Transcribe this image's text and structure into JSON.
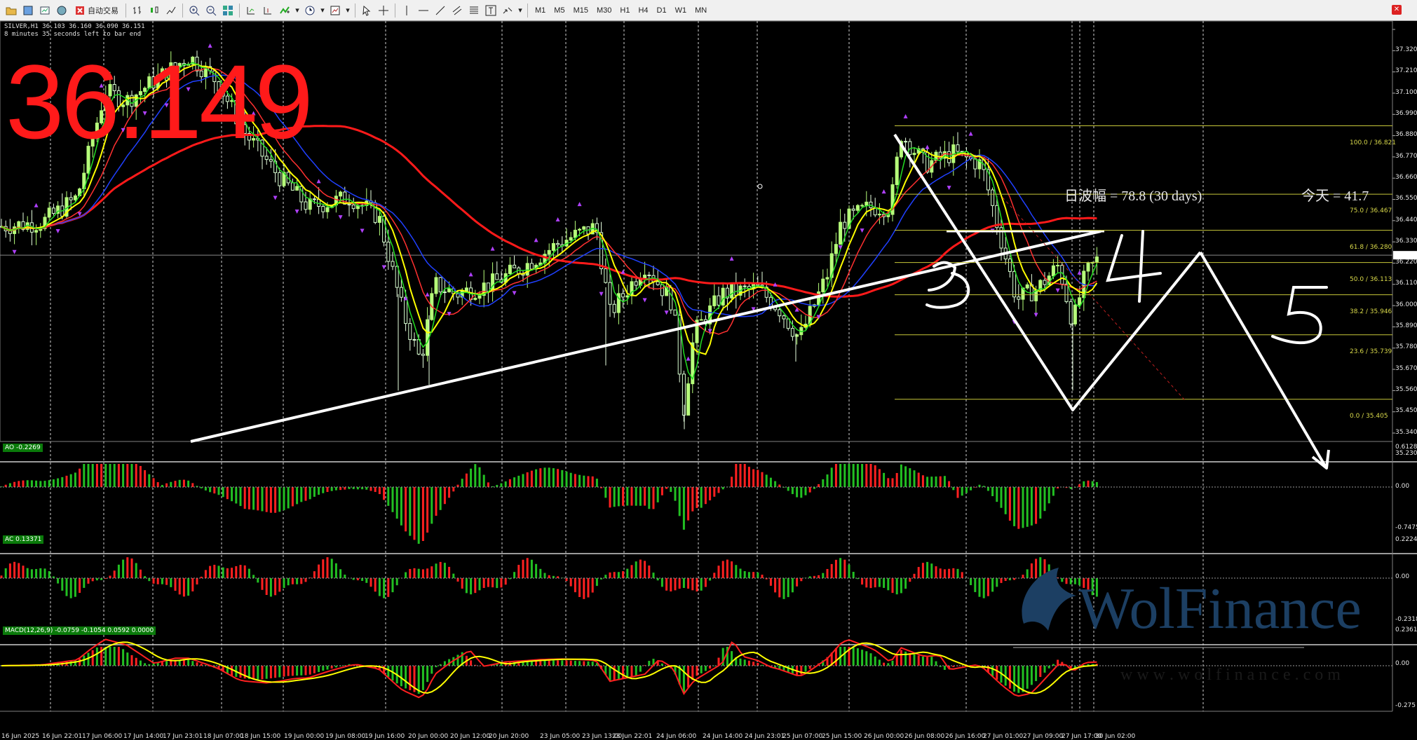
{
  "toolbar": {
    "autotrade_label": "自动交易",
    "timeframes": [
      "M1",
      "M5",
      "M15",
      "M30",
      "H1",
      "H4",
      "D1",
      "W1",
      "MN"
    ]
  },
  "chart": {
    "symbol_line": "SILVER,H1  36.103 36.160 36.090 36.151",
    "timer_line": "8 minutes 35 seconds left to bar end",
    "big_price": "36.149",
    "range_text": "日波幅 = 78.8  (30 days)",
    "today_text": "今天 = 41.7",
    "wave_labels": [
      "3",
      "4",
      "5"
    ],
    "price_axis": [
      "37.320",
      "37.210",
      "37.100",
      "36.990",
      "36.880",
      "36.770",
      "36.660",
      "36.550",
      "36.440",
      "36.330",
      "36.220",
      "36.110",
      "36.000",
      "35.890",
      "35.780",
      "35.670",
      "35.560",
      "35.450",
      "35.340",
      "35.230"
    ],
    "current_price_tag": "36.151",
    "fib_levels": [
      {
        "label": "100.0 / 36.821",
        "price": 36.821
      },
      {
        "label": "75.0 / 36.467",
        "price": 36.467
      },
      {
        "label": "61.8 / 36.280",
        "price": 36.28
      },
      {
        "label": "50.0 / 36.113",
        "price": 36.113
      },
      {
        "label": "38.2 / 35.946",
        "price": 35.946
      },
      {
        "label": "23.6 / 35.739",
        "price": 35.739
      },
      {
        "label": "0.0 / 35.405",
        "price": 35.405
      }
    ],
    "time_axis": [
      "16 Jun 2025",
      "16 Jun 22:01",
      "17 Jun 06:00",
      "17 Jun 14:00",
      "17 Jun 23:01",
      "18 Jun 07:00",
      "18 Jun 15:00",
      "19 Jun 00:00",
      "19 Jun 08:00",
      "19 Jun 16:00",
      "20 Jun 00:00",
      "20 Jun 12:00",
      "20 Jun 20:00",
      "23 Jun 05:00",
      "23 Jun 13:00",
      "23 Jun 22:01",
      "24 Jun 06:00",
      "24 Jun 14:00",
      "24 Jun 23:01",
      "25 Jun 07:00",
      "25 Jun 15:00",
      "26 Jun 00:00",
      "26 Jun 08:00",
      "26 Jun 16:00",
      "27 Jun 01:00",
      "27 Jun 09:00",
      "27 Jun 17:00",
      "30 Jun 02:00"
    ]
  },
  "indicators": {
    "ao": {
      "label": "AO -0.2269",
      "max": "0.6128",
      "zero": "0.00",
      "min": "-0.7475"
    },
    "ac": {
      "label": "AC 0.13371",
      "max": "0.2224",
      "zero": "0.00",
      "min": "-0.2318"
    },
    "macd": {
      "label": "MACD(12,26,9) -0.0759 -0.1054 0.0592 0.0000",
      "max": "0.2361",
      "zero": "0.00",
      "min": "-0.275"
    }
  },
  "watermark": {
    "brand": "WolFinance",
    "url": "w w w . w o l f i n a n c e . c o m"
  },
  "colors": {
    "bull": "#b6ff7a",
    "bear": "#ff2020",
    "ma_red": "#ff1a1a",
    "ma_blue": "#2040ff",
    "ma_yellow": "#ffff00",
    "ma_green": "#22dd22",
    "fib": "#c8c83a"
  }
}
